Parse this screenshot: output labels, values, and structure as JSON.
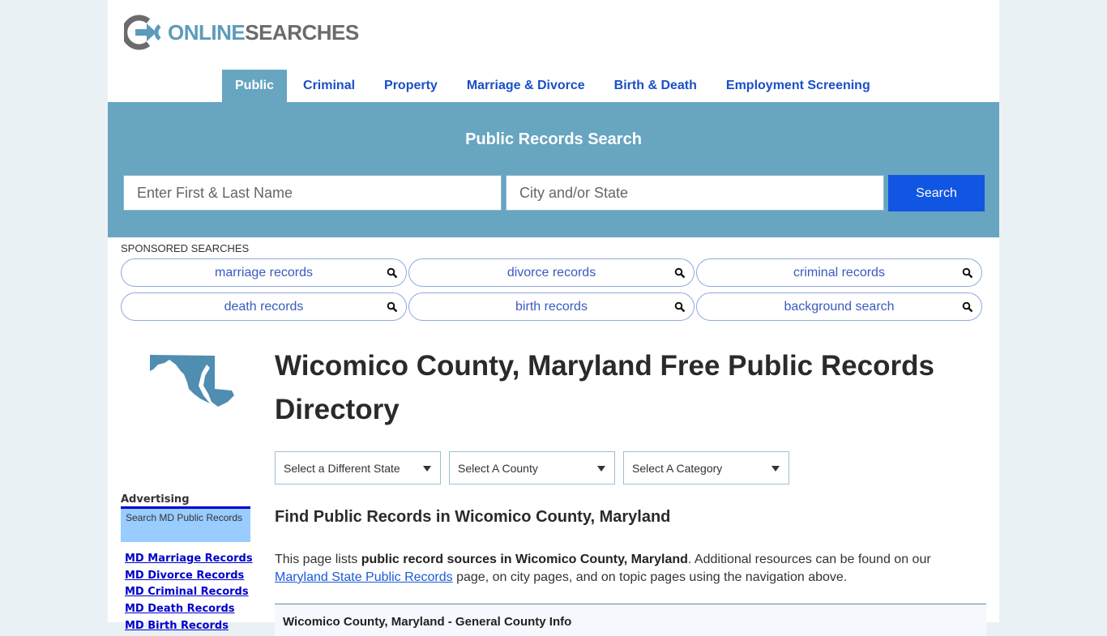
{
  "brand": {
    "part1": "ONLINE",
    "part2": "SEARCHES",
    "accent": "#5c9bbb",
    "gray": "#6b6b6b"
  },
  "nav": {
    "items": [
      {
        "label": "Public",
        "active": true
      },
      {
        "label": "Criminal"
      },
      {
        "label": "Property"
      },
      {
        "label": "Marriage & Divorce"
      },
      {
        "label": "Birth & Death"
      },
      {
        "label": "Employment Screening"
      }
    ]
  },
  "search": {
    "title": "Public Records Search",
    "name_placeholder": "Enter First & Last Name",
    "name_value": "",
    "location_placeholder": "City and/or State",
    "location_value": "",
    "button_label": "Search"
  },
  "sponsored": {
    "label": "SPONSORED SEARCHES",
    "items": [
      "marriage records",
      "divorce records",
      "criminal records",
      "death records",
      "birth records",
      "background search"
    ],
    "icon": "magnifier-icon"
  },
  "map": {
    "state": "Maryland",
    "icon": "maryland-state-map"
  },
  "main": {
    "title": "Wicomico County, Maryland Free Public Records Directory",
    "selects": [
      {
        "selected": "Select a Different State"
      },
      {
        "selected": "Select A County"
      },
      {
        "selected": "Select A Category"
      }
    ],
    "subtitle": "Find Public Records in Wicomico County, Maryland",
    "intro": {
      "before": "This page lists ",
      "bold": "public record sources in Wicomico County, Maryland",
      "after": ". Additional resources can be found on our ",
      "link": "Maryland State Public Records",
      "end": " page, on city pages, and on topic pages using the navigation above."
    },
    "info_box_title": "Wicomico County, Maryland - General County Info"
  },
  "advertising": {
    "title": "Advertising",
    "box_text": "Search MD Public Records",
    "links": [
      "MD Marriage Records",
      "MD Divorce Records",
      "MD Criminal Records",
      "MD Death Records",
      "MD Birth Records"
    ]
  }
}
